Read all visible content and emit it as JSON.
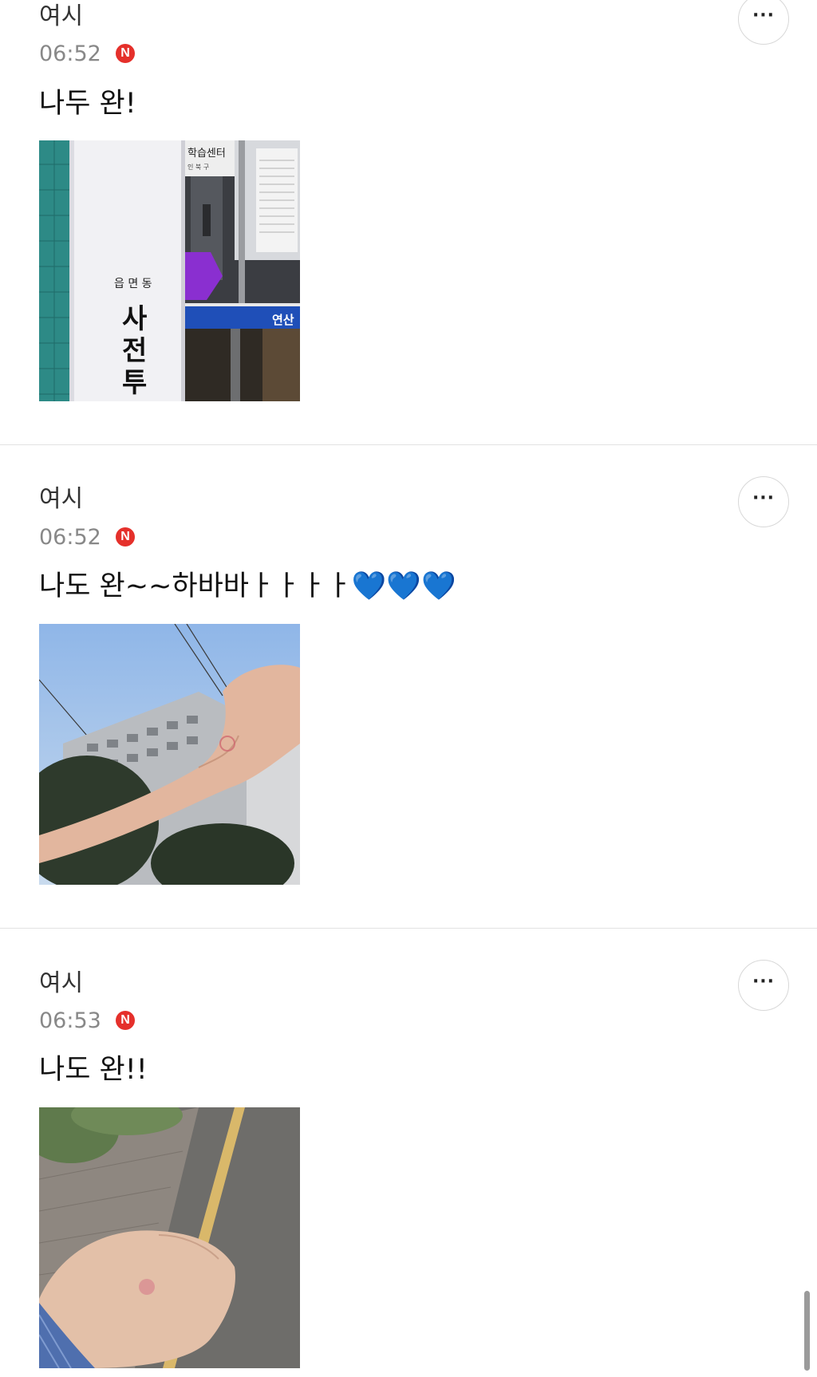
{
  "posts": [
    {
      "author": "여시",
      "time": "06:52",
      "badge": "N",
      "message": "나두 완!",
      "hearts": "",
      "image": "polling-station-entrance-photo"
    },
    {
      "author": "여시",
      "time": "06:52",
      "badge": "N",
      "message": "나도 완~~하바바ㅏㅏㅏㅏ",
      "hearts": "💙💙💙",
      "image": "hand-with-vote-stamp-sky-photo"
    },
    {
      "author": "여시",
      "time": "06:53",
      "badge": "N",
      "message": "나도 완!!",
      "hearts": "",
      "image": "hand-with-vote-stamp-street-photo"
    }
  ],
  "photo1_text": {
    "sign_top": "읍 면 동",
    "sign_main": "사전투",
    "door_sign": "학습센터",
    "door_sub": "인 북 구",
    "stripe_text": "연산"
  },
  "more_button_label": "···",
  "colors": {
    "badge": "#e5302b",
    "heart": "#1a6ff0",
    "time_text": "#888888",
    "divider": "#e2e2e2"
  }
}
